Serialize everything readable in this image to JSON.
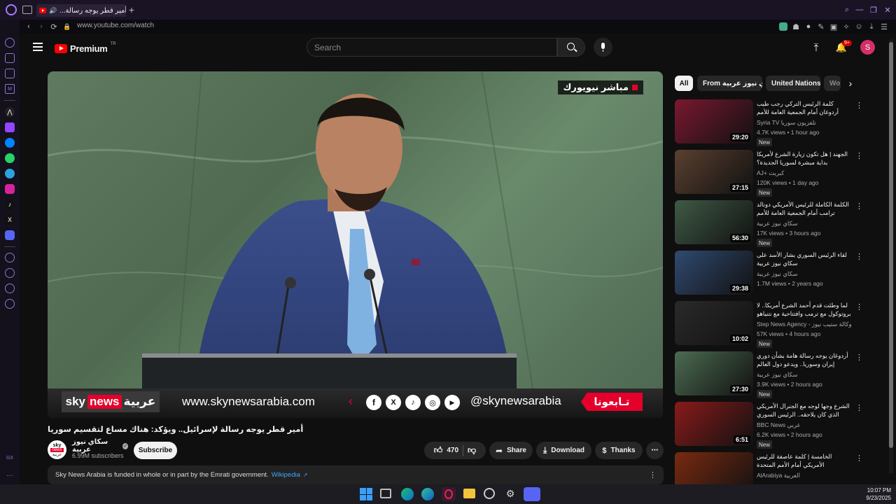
{
  "browser": {
    "tab_title": "(16) أمير قطر يوجه رسالة...",
    "url": "www.youtube.com/watch"
  },
  "yt": {
    "logo_text": "Premium",
    "logo_sup": "TR",
    "search_placeholder": "Search",
    "notif_badge": "9+",
    "avatar_letter": "S"
  },
  "video": {
    "live_tag": "مباشر  نيويورك",
    "banner_site": "www.skynewsarabia.com",
    "banner_handle": "@skynewsarabia",
    "banner_follow": "تـابعونا",
    "banner_logo_sky": "sky",
    "banner_logo_news": "news",
    "banner_logo_ar": "عربية",
    "title": "أمير قطر يوجه رسالة لإسرائيل.. ويؤكد: هناك مساع لتقسيم سوريا",
    "channel_name": "سكاي نيوز عربية",
    "subscribers": "6.99M subscribers",
    "subscribe_label": "Subscribe",
    "likes": "470",
    "share_label": "Share",
    "download_label": "Download",
    "thanks_label": "Thanks",
    "info_text": "Sky News Arabia is funded in whole or in part by the Emrati government.",
    "info_link": "Wikipedia"
  },
  "chips": [
    "All",
    "From سكاي نيوز عربية",
    "United Nations",
    "Wo"
  ],
  "recommendations": [
    {
      "title": "كلمة الرئيس التركي رجب طيب أردوغان أمام الجمعية العامة للأمم المتحدة",
      "channel": "Syria TV تلفزيون سوريا",
      "meta": "4.7K views • 1 hour ago",
      "badge": "New",
      "duration": "29:20",
      "color": "#7a1830"
    },
    {
      "title": "الجهند | هل تكون زيارة الشرع لأمريكا بداية مبشرة لسوريا الجديدة؟",
      "channel": "AJ+ كبريت",
      "meta": "120K views • 1 day ago",
      "badge": "New",
      "duration": "27:15",
      "color": "#5a4030"
    },
    {
      "title": "الكلمة الكاملة للرئيس الأمريكي دونالد ترامب أمام الجمعية العامة للأمم المتحدة",
      "channel": "سكاي نيوز عربية",
      "meta": "17K views • 3 hours ago",
      "badge": "New",
      "duration": "56:30",
      "color": "#3f5a46"
    },
    {
      "title": "لقاء الرئيس السوري بشار الأسد على سكاي نيوز عربية",
      "channel": "سكاي نيوز عربية",
      "meta": "1.7M views • 2 years ago",
      "badge": "",
      "duration": "29:38",
      "color": "#304a70"
    },
    {
      "title": "لما وطئت قدم أحمد الشرع أمريكا.. لا بروتوكول مع ترمب وافتتاحية مع نتنياهو تطلب",
      "channel": "Step News Agency - وكالة ستيب نيوز",
      "meta": "57K views • 4 hours ago",
      "badge": "New",
      "duration": "10:02",
      "color": "#2a2a2a"
    },
    {
      "title": "أردوغان يوجه رسالة هامة بشأن دوري إيران وسوريا.. ويدعو دول العالم للاعتراف",
      "channel": "سكاي نيوز عربية",
      "meta": "3.9K views • 2 hours ago",
      "badge": "New",
      "duration": "27:30",
      "color": "#4c6b52"
    },
    {
      "title": "الشرع وجها لوجه مع الجنرال الأمريكي الذي كان يلاحقه.. الرئيس السوري يجيبه كيف",
      "channel": "BBC News عربي",
      "meta": "6.2K views • 2 hours ago",
      "badge": "New",
      "duration": "6:51",
      "color": "#8a1a1a"
    },
    {
      "title": "الخامسة | كلمة عاصفة للرئيس الأمريكي أمام الأمم المتحدة",
      "channel": "AlArabiya العربية",
      "meta": "",
      "badge": "",
      "duration": "",
      "color": "#7a2a10"
    }
  ],
  "taskbar": {
    "time": "10:07 PM",
    "date": "9/23/2025"
  },
  "sidebar_label": "GX",
  "colors": {
    "yt_red": "#ff0000",
    "subscribe_bg": "#f1f1f1",
    "sky_red": "#e4002b",
    "avatar": "#d32f6a",
    "opera_red": "#e0245e"
  }
}
